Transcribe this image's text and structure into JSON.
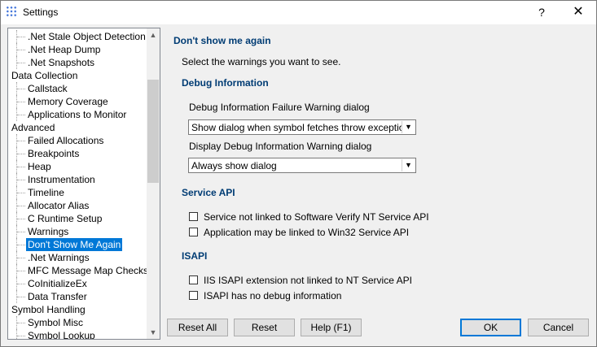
{
  "window": {
    "title": "Settings",
    "help_glyph": "?",
    "close_glyph": "✕"
  },
  "tree": {
    "items": [
      {
        "label": ".Net Stale Object Detection",
        "level": 1
      },
      {
        "label": ".Net Heap Dump",
        "level": 1
      },
      {
        "label": ".Net Snapshots",
        "level": 1
      },
      {
        "label": "Data Collection",
        "level": 0
      },
      {
        "label": "Callstack",
        "level": 1
      },
      {
        "label": "Memory Coverage",
        "level": 1
      },
      {
        "label": "Applications to Monitor",
        "level": 1
      },
      {
        "label": "Advanced",
        "level": 0
      },
      {
        "label": "Failed Allocations",
        "level": 1
      },
      {
        "label": "Breakpoints",
        "level": 1
      },
      {
        "label": "Heap",
        "level": 1
      },
      {
        "label": "Instrumentation",
        "level": 1
      },
      {
        "label": "Timeline",
        "level": 1
      },
      {
        "label": "Allocator Alias",
        "level": 1
      },
      {
        "label": "C Runtime Setup",
        "level": 1
      },
      {
        "label": "Warnings",
        "level": 1
      },
      {
        "label": "Don't Show Me Again",
        "level": 1,
        "selected": true
      },
      {
        "label": ".Net Warnings",
        "level": 1
      },
      {
        "label": "MFC Message Map Checks",
        "level": 1
      },
      {
        "label": "CoInitializeEx",
        "level": 1
      },
      {
        "label": "Data Transfer",
        "level": 1
      },
      {
        "label": "Symbol Handling",
        "level": 0
      },
      {
        "label": "Symbol Misc",
        "level": 1
      },
      {
        "label": "Symbol Lookup",
        "level": 1
      }
    ],
    "scroll_up": "▲",
    "scroll_down": "▼"
  },
  "panel": {
    "title": "Don't show me again",
    "subtitle": "Select the warnings you want to see.",
    "debug_info": {
      "heading": "Debug Information",
      "field1_label": "Debug Information Failure Warning dialog",
      "field1_value": "Show dialog when symbol fetches throw exceptions",
      "field2_label": "Display Debug Information Warning dialog",
      "field2_value": "Always show dialog"
    },
    "service_api": {
      "heading": "Service API",
      "check1": "Service not linked to Software Verify NT Service API",
      "check2": "Application may be linked to Win32 Service API"
    },
    "isapi": {
      "heading": "ISAPI",
      "check1": "IIS ISAPI extension not linked to NT Service API",
      "check2": "ISAPI has no debug information"
    }
  },
  "buttons": {
    "reset_all": "Reset All",
    "reset": "Reset",
    "help": "Help (F1)",
    "ok": "OK",
    "cancel": "Cancel"
  },
  "combo_arrow": "▼"
}
